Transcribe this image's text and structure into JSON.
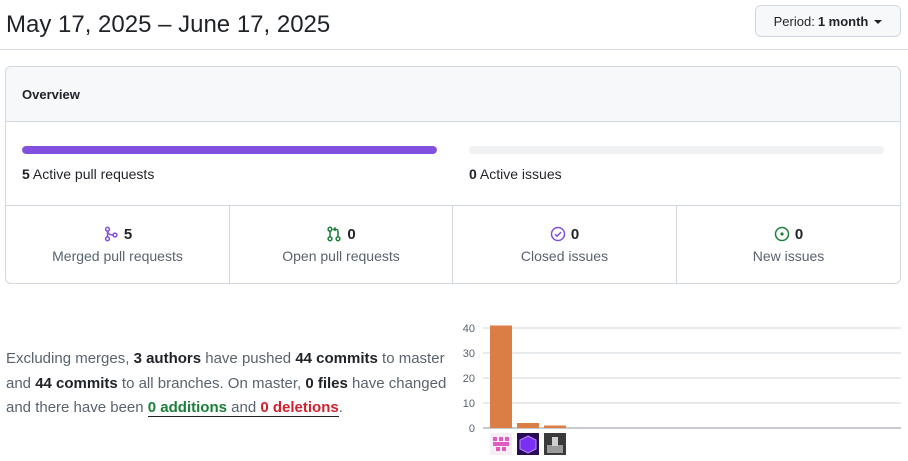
{
  "header": {
    "date_range": "May 17, 2025 – June 17, 2025",
    "period_label": "Period:",
    "period_value": "1 month"
  },
  "overview": {
    "title": "Overview",
    "pull_requests": {
      "count": "5",
      "label": "Active pull requests",
      "fill_fraction": 1.0,
      "bar_color": "#8250df"
    },
    "issues": {
      "count": "0",
      "label": "Active issues",
      "fill_fraction": 0.0
    },
    "stats": [
      {
        "icon": "merged-pr-icon",
        "value": "5",
        "label": "Merged pull requests",
        "color": "#8250df"
      },
      {
        "icon": "open-pr-icon",
        "value": "0",
        "label": "Open pull requests",
        "color": "#1a7f37"
      },
      {
        "icon": "closed-issue-icon",
        "value": "0",
        "label": "Closed issues",
        "color": "#8250df"
      },
      {
        "icon": "new-issue-icon",
        "value": "0",
        "label": "New issues",
        "color": "#1a7f37"
      }
    ]
  },
  "summary": {
    "t1": "Excluding merges, ",
    "authors": "3 authors",
    "t2": " have pushed ",
    "commits_master": "44 commits",
    "t3": " to master and ",
    "commits_all": "44 commits",
    "t4": " to all branches. On master, ",
    "files": "0 files",
    "t5": " have changed and there have been ",
    "additions": "0 additions",
    "t6": " and ",
    "deletions": "0 deletions",
    "t7": "."
  },
  "chart_data": {
    "type": "bar",
    "categories": [
      "author-1",
      "author-2",
      "author-3"
    ],
    "values": [
      41,
      2,
      1
    ],
    "ylim": [
      0,
      44
    ],
    "yticks": [
      0,
      10,
      20,
      30,
      40
    ],
    "bar_color": "#da7e46",
    "grid": true,
    "xlabel": "",
    "ylabel": "",
    "avatars": [
      "pink-pixel-avatar",
      "purple-cube-avatar",
      "grayscale-photo-avatar"
    ]
  }
}
